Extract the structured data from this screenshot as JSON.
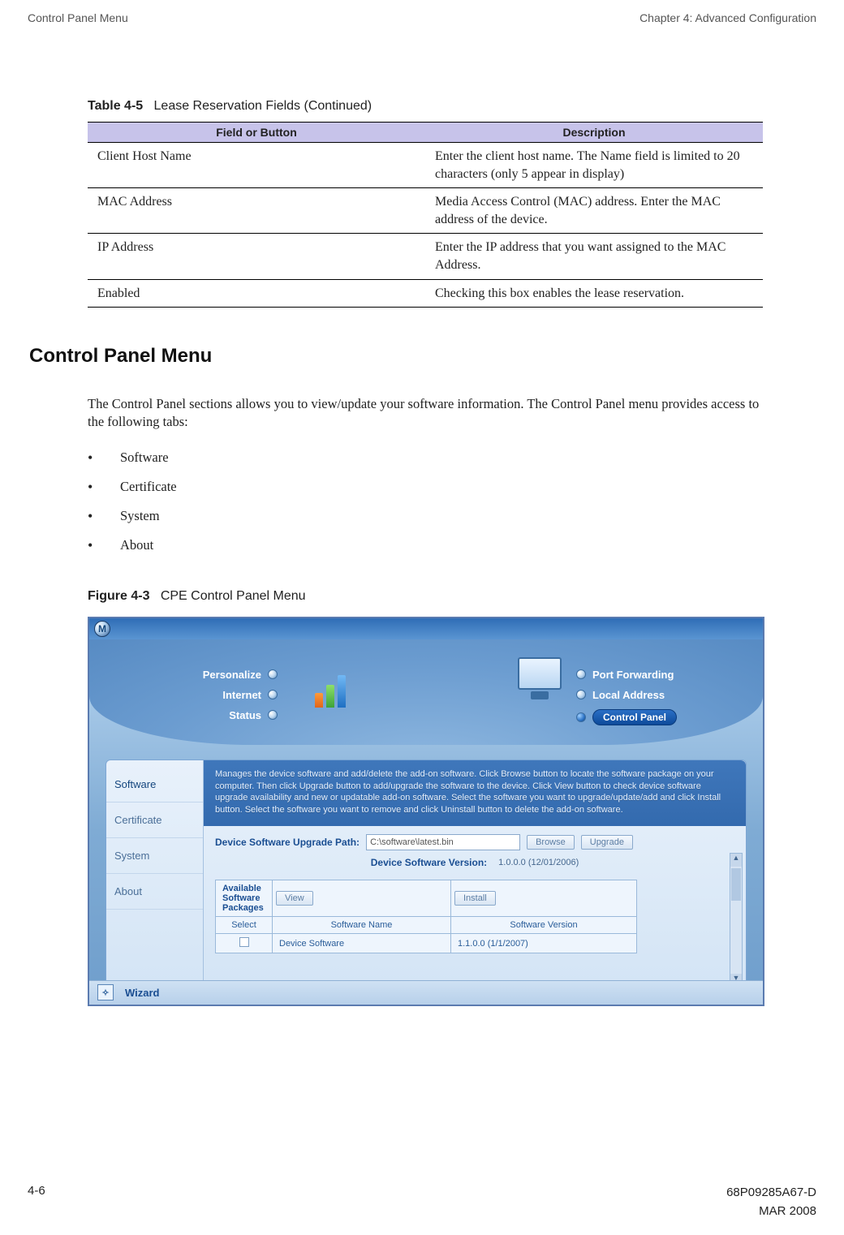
{
  "header": {
    "left": "Control Panel Menu",
    "right": "Chapter 4: Advanced Configuration"
  },
  "table": {
    "caption_num": "Table 4-5",
    "caption_text": "Lease Reservation Fields (Continued)",
    "col1": "Field or Button",
    "col2": "Description",
    "rows": [
      {
        "f": "Client Host Name",
        "d": "Enter the client host name. The Name field is limited to 20 characters (only 5 appear in display)"
      },
      {
        "f": "MAC Address",
        "d": "Media Access Control (MAC) address. Enter the MAC address of the device."
      },
      {
        "f": "IP Address",
        "d": "Enter the IP address that you want assigned to the MAC Address."
      },
      {
        "f": "Enabled",
        "d": "Checking this box enables the lease reservation."
      }
    ]
  },
  "section_heading": "Control Panel Menu",
  "body_para": "The Control Panel sections allows you to view/update your software information. The Control Panel menu provides access to the following tabs:",
  "bullets": [
    "Software",
    "Certificate",
    "System",
    "About"
  ],
  "figure": {
    "caption_num": "Figure 4-3",
    "caption_text": "CPE Control Panel Menu"
  },
  "app": {
    "logo_letter": "M",
    "leftnav": [
      {
        "label": "Personalize",
        "active": false
      },
      {
        "label": "Internet",
        "active": false
      },
      {
        "label": "Status",
        "active": false
      }
    ],
    "rightnav": [
      {
        "label": "Port Forwarding",
        "type": "row"
      },
      {
        "label": "Local Address",
        "type": "row"
      },
      {
        "label": "Control Panel",
        "type": "pill"
      }
    ],
    "tabs": [
      "Software",
      "Certificate",
      "System",
      "About"
    ],
    "active_tab": "Software",
    "help_text": "Manages the device software and add/delete the add-on software. Click Browse button to locate the software package on your computer. Then click Upgrade button to add/upgrade the software to the device. Click View button to check device software upgrade availability and new or updatable add-on software. Select the software you want to upgrade/update/add and click Install button. Select the software you want to remove and click Uninstall button to delete the add-on software.",
    "upgrade_path_label": "Device Software Upgrade Path:",
    "upgrade_path_value": "C:\\software\\latest.bin",
    "browse_btn": "Browse",
    "upgrade_btn": "Upgrade",
    "version_label": "Device Software Version:",
    "version_value": "1.0.0.0 (12/01/2006)",
    "pkg_header": "Available Software Packages",
    "view_btn": "View",
    "install_btn": "Install",
    "pkg_cols": {
      "select": "Select",
      "name": "Software Name",
      "ver": "Software Version"
    },
    "pkg_row": {
      "name": "Device Software",
      "ver": "1.1.0.0 (1/1/2007)"
    },
    "wizard": "Wizard"
  },
  "footer": {
    "page": "4-6",
    "docnum": "68P09285A67-D",
    "date": "MAR 2008"
  }
}
